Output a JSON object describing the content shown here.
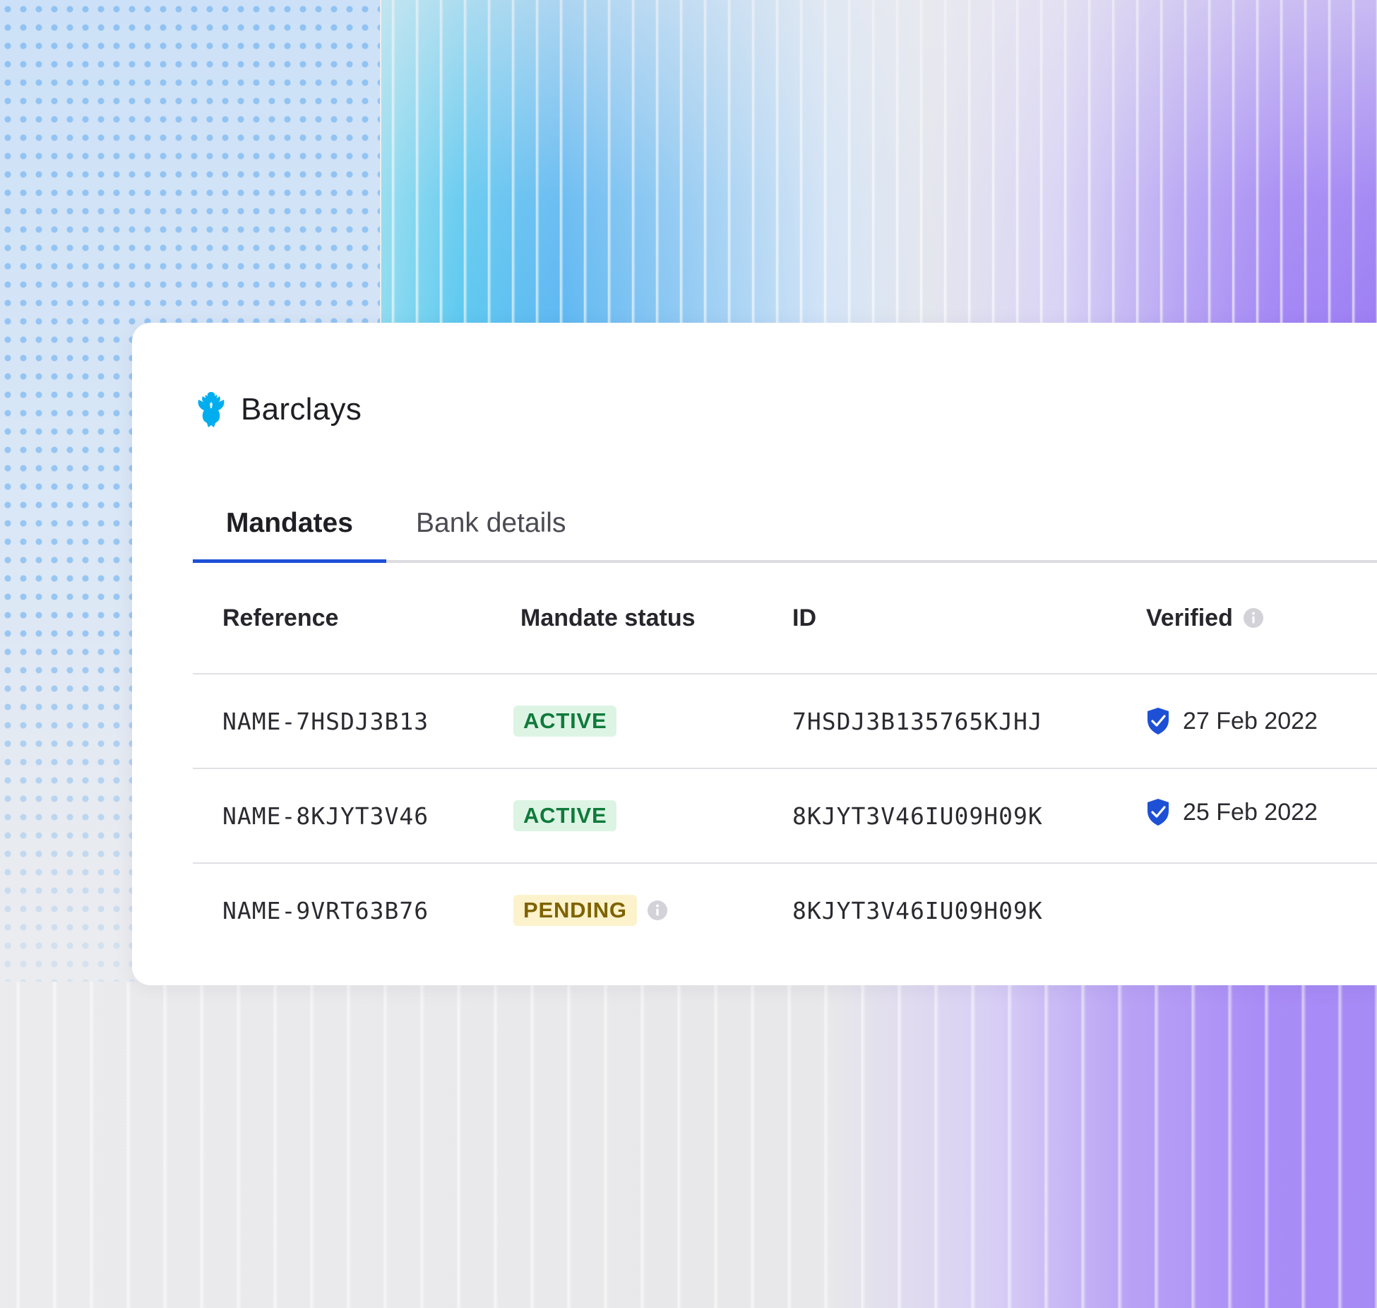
{
  "brand": {
    "name": "Barclays",
    "logo_icon": "barclays-eagle-icon",
    "logo_color": "#00aeef"
  },
  "tabs": [
    {
      "label": "Mandates",
      "active": true
    },
    {
      "label": "Bank details",
      "active": false
    }
  ],
  "table": {
    "headers": {
      "reference": "Reference",
      "status": "Mandate status",
      "id": "ID",
      "verified": "Verified"
    },
    "rows": [
      {
        "reference": "NAME-7HSDJ3B13",
        "status": "ACTIVE",
        "id": "7HSDJ3B135765KJHJ",
        "verified": "27 Feb 2022"
      },
      {
        "reference": "NAME-8KJYT3V46",
        "status": "ACTIVE",
        "id": "8KJYT3V46IU09H09K",
        "verified": "25 Feb 2022"
      },
      {
        "reference": "NAME-9VRT63B76",
        "status": "PENDING",
        "id": "8KJYT3V46IU09H09K",
        "verified": ""
      }
    ]
  },
  "colors": {
    "accent": "#1e50d6",
    "active_badge_bg": "#ddf4e4",
    "active_badge_text": "#0f7a3b",
    "pending_badge_bg": "#fcf2cc",
    "pending_badge_text": "#7e6300",
    "verified_shield": "#1e50d6"
  }
}
